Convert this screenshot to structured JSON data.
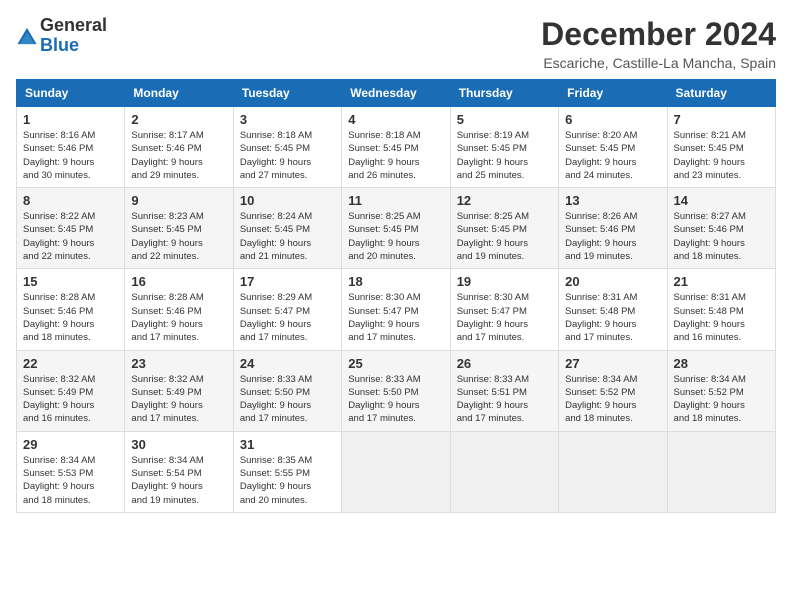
{
  "logo": {
    "line1": "General",
    "line2": "Blue"
  },
  "title": "December 2024",
  "subtitle": "Escariche, Castille-La Mancha, Spain",
  "days_of_week": [
    "Sunday",
    "Monday",
    "Tuesday",
    "Wednesday",
    "Thursday",
    "Friday",
    "Saturday"
  ],
  "weeks": [
    [
      {
        "day": "1",
        "info": "Sunrise: 8:16 AM\nSunset: 5:46 PM\nDaylight: 9 hours\nand 30 minutes."
      },
      {
        "day": "2",
        "info": "Sunrise: 8:17 AM\nSunset: 5:46 PM\nDaylight: 9 hours\nand 29 minutes."
      },
      {
        "day": "3",
        "info": "Sunrise: 8:18 AM\nSunset: 5:45 PM\nDaylight: 9 hours\nand 27 minutes."
      },
      {
        "day": "4",
        "info": "Sunrise: 8:18 AM\nSunset: 5:45 PM\nDaylight: 9 hours\nand 26 minutes."
      },
      {
        "day": "5",
        "info": "Sunrise: 8:19 AM\nSunset: 5:45 PM\nDaylight: 9 hours\nand 25 minutes."
      },
      {
        "day": "6",
        "info": "Sunrise: 8:20 AM\nSunset: 5:45 PM\nDaylight: 9 hours\nand 24 minutes."
      },
      {
        "day": "7",
        "info": "Sunrise: 8:21 AM\nSunset: 5:45 PM\nDaylight: 9 hours\nand 23 minutes."
      }
    ],
    [
      {
        "day": "8",
        "info": "Sunrise: 8:22 AM\nSunset: 5:45 PM\nDaylight: 9 hours\nand 22 minutes."
      },
      {
        "day": "9",
        "info": "Sunrise: 8:23 AM\nSunset: 5:45 PM\nDaylight: 9 hours\nand 22 minutes."
      },
      {
        "day": "10",
        "info": "Sunrise: 8:24 AM\nSunset: 5:45 PM\nDaylight: 9 hours\nand 21 minutes."
      },
      {
        "day": "11",
        "info": "Sunrise: 8:25 AM\nSunset: 5:45 PM\nDaylight: 9 hours\nand 20 minutes."
      },
      {
        "day": "12",
        "info": "Sunrise: 8:25 AM\nSunset: 5:45 PM\nDaylight: 9 hours\nand 19 minutes."
      },
      {
        "day": "13",
        "info": "Sunrise: 8:26 AM\nSunset: 5:46 PM\nDaylight: 9 hours\nand 19 minutes."
      },
      {
        "day": "14",
        "info": "Sunrise: 8:27 AM\nSunset: 5:46 PM\nDaylight: 9 hours\nand 18 minutes."
      }
    ],
    [
      {
        "day": "15",
        "info": "Sunrise: 8:28 AM\nSunset: 5:46 PM\nDaylight: 9 hours\nand 18 minutes."
      },
      {
        "day": "16",
        "info": "Sunrise: 8:28 AM\nSunset: 5:46 PM\nDaylight: 9 hours\nand 17 minutes."
      },
      {
        "day": "17",
        "info": "Sunrise: 8:29 AM\nSunset: 5:47 PM\nDaylight: 9 hours\nand 17 minutes."
      },
      {
        "day": "18",
        "info": "Sunrise: 8:30 AM\nSunset: 5:47 PM\nDaylight: 9 hours\nand 17 minutes."
      },
      {
        "day": "19",
        "info": "Sunrise: 8:30 AM\nSunset: 5:47 PM\nDaylight: 9 hours\nand 17 minutes."
      },
      {
        "day": "20",
        "info": "Sunrise: 8:31 AM\nSunset: 5:48 PM\nDaylight: 9 hours\nand 17 minutes."
      },
      {
        "day": "21",
        "info": "Sunrise: 8:31 AM\nSunset: 5:48 PM\nDaylight: 9 hours\nand 16 minutes."
      }
    ],
    [
      {
        "day": "22",
        "info": "Sunrise: 8:32 AM\nSunset: 5:49 PM\nDaylight: 9 hours\nand 16 minutes."
      },
      {
        "day": "23",
        "info": "Sunrise: 8:32 AM\nSunset: 5:49 PM\nDaylight: 9 hours\nand 17 minutes."
      },
      {
        "day": "24",
        "info": "Sunrise: 8:33 AM\nSunset: 5:50 PM\nDaylight: 9 hours\nand 17 minutes."
      },
      {
        "day": "25",
        "info": "Sunrise: 8:33 AM\nSunset: 5:50 PM\nDaylight: 9 hours\nand 17 minutes."
      },
      {
        "day": "26",
        "info": "Sunrise: 8:33 AM\nSunset: 5:51 PM\nDaylight: 9 hours\nand 17 minutes."
      },
      {
        "day": "27",
        "info": "Sunrise: 8:34 AM\nSunset: 5:52 PM\nDaylight: 9 hours\nand 18 minutes."
      },
      {
        "day": "28",
        "info": "Sunrise: 8:34 AM\nSunset: 5:52 PM\nDaylight: 9 hours\nand 18 minutes."
      }
    ],
    [
      {
        "day": "29",
        "info": "Sunrise: 8:34 AM\nSunset: 5:53 PM\nDaylight: 9 hours\nand 18 minutes."
      },
      {
        "day": "30",
        "info": "Sunrise: 8:34 AM\nSunset: 5:54 PM\nDaylight: 9 hours\nand 19 minutes."
      },
      {
        "day": "31",
        "info": "Sunrise: 8:35 AM\nSunset: 5:55 PM\nDaylight: 9 hours\nand 20 minutes."
      },
      null,
      null,
      null,
      null
    ]
  ]
}
